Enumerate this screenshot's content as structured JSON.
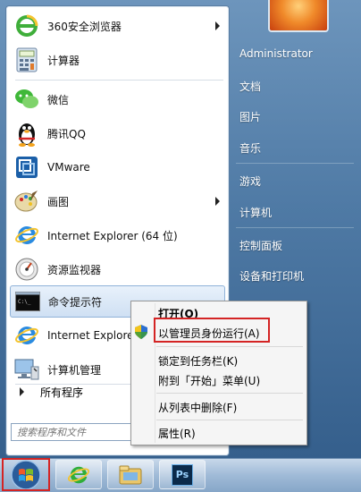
{
  "programs": [
    {
      "label": "360安全浏览器",
      "icon": "360-browser-icon",
      "submenu": true
    },
    {
      "label": "计算器",
      "icon": "calculator-icon",
      "submenu": false
    },
    {
      "label": "微信",
      "icon": "wechat-icon",
      "submenu": false
    },
    {
      "label": "腾讯QQ",
      "icon": "qq-penguin-icon",
      "submenu": false
    },
    {
      "label": "VMware",
      "icon": "vmware-icon",
      "submenu": false
    },
    {
      "label": "画图",
      "icon": "paint-icon",
      "submenu": true
    },
    {
      "label": "Internet Explorer (64 位)",
      "icon": "internet-explorer-icon",
      "submenu": false
    },
    {
      "label": "资源监视器",
      "icon": "resource-monitor-icon",
      "submenu": false
    },
    {
      "label": "命令提示符",
      "icon": "command-prompt-icon",
      "submenu": false
    },
    {
      "label": "Internet Explorer",
      "icon": "internet-explorer-icon",
      "submenu": false
    },
    {
      "label": "计算机管理",
      "icon": "computer-management-icon",
      "submenu": false
    }
  ],
  "all_programs_label": "所有程序",
  "search": {
    "placeholder": "搜索程序和文件"
  },
  "right_pane": {
    "items": [
      "Administrator",
      "文档",
      "图片",
      "音乐",
      "游戏",
      "计算机",
      "控制面板",
      "设备和打印机"
    ]
  },
  "context_menu": {
    "items": [
      {
        "label": "打开(O)",
        "bold": true
      },
      {
        "label": "以管理员身份运行(A)",
        "bold": false
      },
      {
        "label": "锁定到任务栏(K)",
        "bold": false
      },
      {
        "label": "附到「开始」菜单(U)",
        "bold": false
      },
      {
        "label": "从列表中删除(F)",
        "bold": false
      },
      {
        "label": "属性(R)",
        "bold": false
      }
    ]
  },
  "taskbar": {
    "items": [
      "start-orb",
      "internet-explorer",
      "file-explorer",
      "photoshop"
    ],
    "ps_label": "Ps"
  },
  "colors": {
    "highlight_red": "#d42424",
    "menu_blue": "#4f7aa5"
  }
}
